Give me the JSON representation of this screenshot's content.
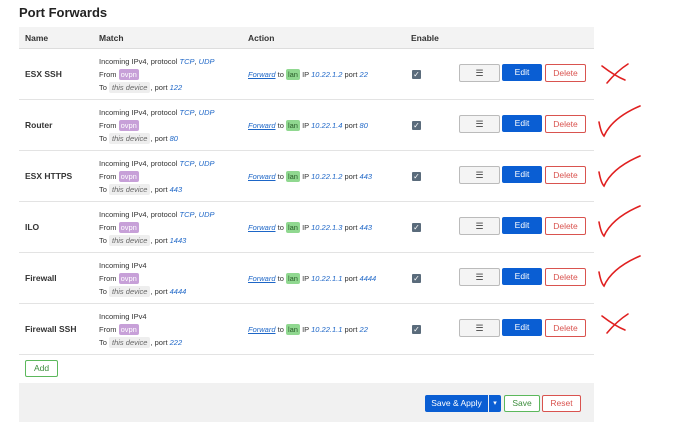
{
  "page": {
    "title": "Port Forwards"
  },
  "table": {
    "headers": {
      "name": "Name",
      "match": "Match",
      "action": "Action",
      "enable": "Enable"
    },
    "match_labels": {
      "from": "From",
      "to": "To",
      "port_sep": ", port",
      "protocol_sep": ", protocol",
      "proto_sep": ", "
    },
    "action_labels": {
      "forward": "Forward",
      "to": "to",
      "ip": "IP",
      "port": "port"
    },
    "buttons": {
      "menu": "☰",
      "edit": "Edit",
      "delete": "Delete"
    },
    "rows": [
      {
        "name": "ESX SSH",
        "incoming": "Incoming IPv4",
        "has_protocol": true,
        "proto1": "TCP",
        "proto2": "UDP",
        "from_zone": "ovpn",
        "to_dest": "this device",
        "ext_port": "122",
        "dest_zone": "lan",
        "ip": "10.22.1.2",
        "int_port": "22",
        "enabled": true
      },
      {
        "name": "Router",
        "incoming": "Incoming IPv4",
        "has_protocol": true,
        "proto1": "TCP",
        "proto2": "UDP",
        "from_zone": "ovpn",
        "to_dest": "this device",
        "ext_port": "80",
        "dest_zone": "lan",
        "ip": "10.22.1.4",
        "int_port": "80",
        "enabled": true
      },
      {
        "name": "ESX HTTPS",
        "incoming": "Incoming IPv4",
        "has_protocol": true,
        "proto1": "TCP",
        "proto2": "UDP",
        "from_zone": "ovpn",
        "to_dest": "this device",
        "ext_port": "443",
        "dest_zone": "lan",
        "ip": "10.22.1.2",
        "int_port": "443",
        "enabled": true
      },
      {
        "name": "ILO",
        "incoming": "Incoming IPv4",
        "has_protocol": true,
        "proto1": "TCP",
        "proto2": "UDP",
        "from_zone": "ovpn",
        "to_dest": "this device",
        "ext_port": "1443",
        "dest_zone": "lan",
        "ip": "10.22.1.3",
        "int_port": "443",
        "enabled": true
      },
      {
        "name": "Firewall",
        "incoming": "Incoming IPv4",
        "has_protocol": false,
        "proto1": "",
        "proto2": "",
        "from_zone": "ovpn",
        "to_dest": "this device",
        "ext_port": "4444",
        "dest_zone": "lan",
        "ip": "10.22.1.1",
        "int_port": "4444",
        "enabled": true
      },
      {
        "name": "Firewall SSH",
        "incoming": "Incoming IPv4",
        "has_protocol": false,
        "proto1": "",
        "proto2": "",
        "from_zone": "ovpn",
        "to_dest": "this device",
        "ext_port": "222",
        "dest_zone": "lan",
        "ip": "10.22.1.1",
        "int_port": "22",
        "enabled": true
      }
    ]
  },
  "add_button": "Add",
  "footer": {
    "save_apply": "Save & Apply",
    "dropdown": "▾",
    "save": "Save",
    "reset": "Reset"
  },
  "annotations": [
    "cross",
    "check",
    "check",
    "check",
    "check",
    "cross"
  ],
  "colors": {
    "primary": "#0a5ed3",
    "danger": "#d9534f",
    "success": "#5cb85c",
    "zone_ovpn": "#c7a0d8",
    "zone_lan": "#90d890",
    "annotation": "#e02020"
  }
}
